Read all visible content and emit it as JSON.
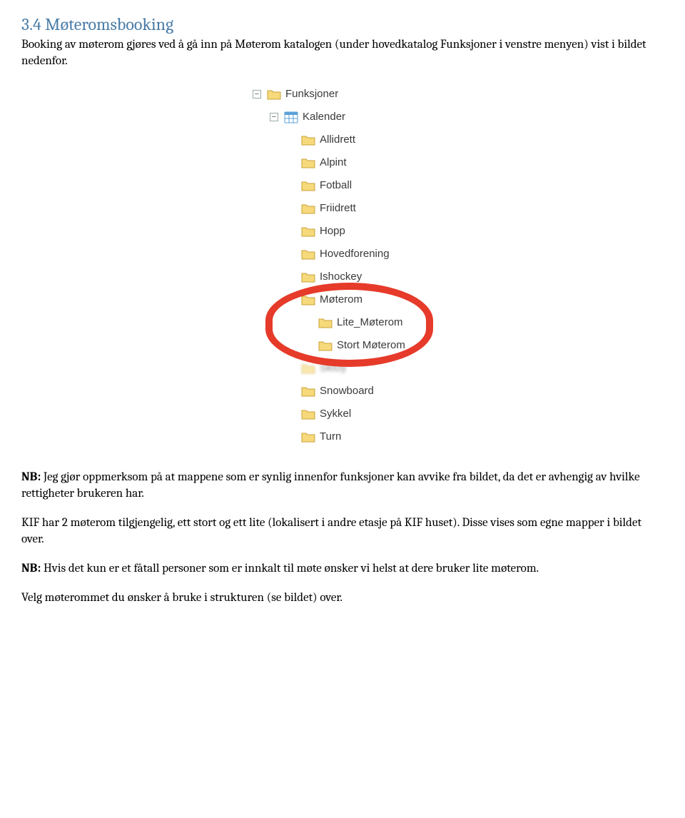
{
  "heading": "3.4 Møteromsbooking",
  "intro": "Booking av møterom gjøres ved å gå inn på Møterom katalogen (under hovedkatalog Funksjoner i venstre menyen) vist i bildet nedenfor.",
  "tree": {
    "root": "Funksjoner",
    "calendar": "Kalender",
    "items": [
      "Allidrett",
      "Alpint",
      "Fotball",
      "Friidrett",
      "Hopp",
      "Hovedforening",
      "Ishockey"
    ],
    "moterom": "Møterom",
    "moterom_children": [
      "Lite_Møterom",
      "Stort Møterom"
    ],
    "items2": [
      "Snowboard",
      "Sykkel",
      "Turn"
    ],
    "blurred": "Sktoy"
  },
  "nb1_label": "NB:",
  "nb1_text": " Jeg gjør oppmerksom på at mappene som er synlig innenfor funksjoner kan avvike fra bildet, da det er avhengig av hvilke rettigheter brukeren har.",
  "para2": "KIF har 2 møterom tilgjengelig, ett stort og ett lite (lokalisert i andre etasje på KIF huset). Disse vises som egne mapper i bildet over.",
  "nb2_label": "NB:",
  "nb2_text": " Hvis det kun er et fåtall personer som er innkalt til møte ønsker vi helst at dere bruker lite møterom.",
  "para3": "Velg møterommet du ønsker å bruke i strukturen (se bildet) over."
}
